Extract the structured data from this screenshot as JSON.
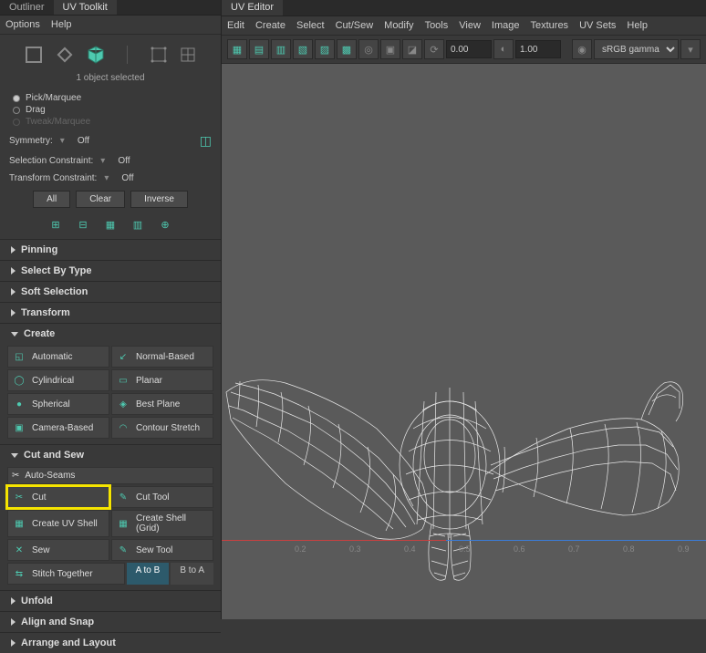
{
  "left": {
    "tabs": [
      "Outliner",
      "UV Toolkit"
    ],
    "active_tab": 1,
    "menus": [
      "Options",
      "Help"
    ],
    "selection_info": "1 object selected",
    "radios": [
      "Pick/Marquee",
      "Drag",
      "Tweak/Marquee"
    ],
    "symmetry": {
      "label": "Symmetry:",
      "value": "Off"
    },
    "selection_constraint": {
      "label": "Selection Constraint:",
      "value": "Off"
    },
    "transform_constraint": {
      "label": "Transform Constraint:",
      "value": "Off"
    },
    "sel_buttons": [
      "All",
      "Clear",
      "Inverse"
    ],
    "sections_collapsed": [
      "Pinning",
      "Select By Type",
      "Soft Selection",
      "Transform"
    ],
    "create": {
      "title": "Create",
      "items": [
        "Automatic",
        "Normal-Based",
        "Cylindrical",
        "Planar",
        "Spherical",
        "Best Plane",
        "Camera-Based",
        "Contour Stretch"
      ]
    },
    "cut_and_sew": {
      "title": "Cut and Sew",
      "auto_seams": "Auto-Seams",
      "rows": [
        [
          "Cut",
          "Cut Tool"
        ],
        [
          "Create UV Shell",
          "Create Shell (Grid)"
        ],
        [
          "Sew",
          "Sew Tool"
        ]
      ],
      "stitch": "Stitch Together",
      "ab": [
        "A to B",
        "B to A"
      ]
    },
    "sections_bottom": [
      "Unfold",
      "Align and Snap",
      "Arrange and Layout"
    ]
  },
  "right": {
    "tabs": [
      "UV Editor"
    ],
    "menus": [
      "Edit",
      "Create",
      "Select",
      "Cut/Sew",
      "Modify",
      "Tools",
      "View",
      "Image",
      "Textures",
      "UV Sets",
      "Help"
    ],
    "field1": "0.00",
    "field2": "1.00",
    "color_mode": "sRGB gamma",
    "ticks": [
      "0.2",
      "0.3",
      "0.4",
      "0.5",
      "0.6",
      "0.7",
      "0.8",
      "0.9"
    ]
  }
}
